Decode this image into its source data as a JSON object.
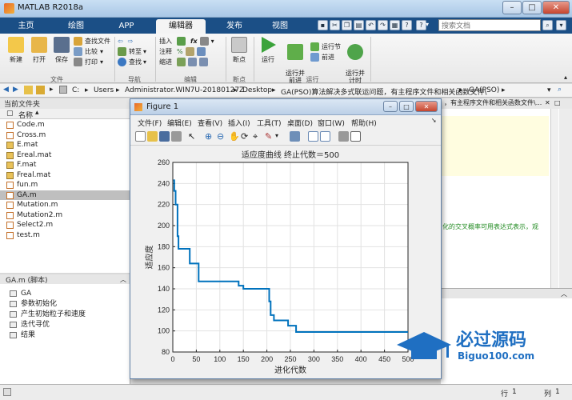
{
  "window": {
    "title": "MATLAB R2018a"
  },
  "tabs": [
    "主页",
    "绘图",
    "APP",
    "编辑器",
    "发布",
    "视图"
  ],
  "active_tab": "编辑器",
  "search": {
    "placeholder": "搜索文档"
  },
  "ribbon": {
    "file_group": {
      "label": "文件",
      "new": "新建",
      "open": "打开",
      "save": "保存",
      "find_files": "查找文件",
      "compare": "比较",
      "print": "打印"
    },
    "nav_group": {
      "label": "导航",
      "goto": "转至",
      "find": "查找"
    },
    "edit_group": {
      "label": "编辑",
      "insert": "插入",
      "comment": "注释",
      "indent": "缩进"
    },
    "breakpoint_group": {
      "label": "断点",
      "breakpoints": "断点"
    },
    "run_group": {
      "label": "运行",
      "run": "运行",
      "run_advance": "运行并\n前进",
      "run_section": "运行节",
      "advance": "前进",
      "run_time": "运行并\n计时"
    }
  },
  "address": {
    "path": [
      "C:",
      "Users",
      "Administrator.WIN7U-20180127Z",
      "Desktop",
      "GA(PSO)算法解决多式联运问题，有主程序文件和相关函数文件\\",
      "GA(PSO)"
    ]
  },
  "current_folder": {
    "title": "当前文件夹",
    "col_name": "名称",
    "files": [
      {
        "name": "Code.m",
        "type": "m"
      },
      {
        "name": "Cross.m",
        "type": "m"
      },
      {
        "name": "E.mat",
        "type": "mat"
      },
      {
        "name": "Ereal.mat",
        "type": "mat"
      },
      {
        "name": "F.mat",
        "type": "mat"
      },
      {
        "name": "Freal.mat",
        "type": "mat"
      },
      {
        "name": "fun.m",
        "type": "m"
      },
      {
        "name": "GA.m",
        "type": "m",
        "selected": true
      },
      {
        "name": "Mutation.m",
        "type": "m"
      },
      {
        "name": "Mutation2.m",
        "type": "m"
      },
      {
        "name": "Select2.m",
        "type": "m"
      },
      {
        "name": "test.m",
        "type": "m"
      }
    ]
  },
  "details": {
    "title": "GA.m  (脚本)",
    "outline": [
      "GA",
      "参数初始化",
      "产生初始粒子和速度",
      "迭代寻优",
      "结果"
    ]
  },
  "editor": {
    "tab_text": "，有主程序文件和相关函数文件\\...",
    "green_text": "化的交叉概率可用表达式表示，观"
  },
  "status": {
    "row_label": "行",
    "row_value": "1",
    "col_label": "列",
    "col_value": "1"
  },
  "figure": {
    "title": "Figure 1",
    "menu": [
      "文件(F)",
      "编辑(E)",
      "查看(V)",
      "插入(I)",
      "工具(T)",
      "桌面(D)",
      "窗口(W)",
      "帮助(H)"
    ]
  },
  "watermark": {
    "text": "必过源码",
    "sub": "Biguo100.com"
  },
  "chart_data": {
    "type": "line",
    "title": "适应度曲线  终止代数＝500",
    "xlabel": "进化代数",
    "ylabel": "适应度",
    "xlim": [
      0,
      500
    ],
    "ylim": [
      80,
      260
    ],
    "xticks": [
      0,
      50,
      100,
      150,
      200,
      250,
      300,
      350,
      400,
      450,
      500
    ],
    "yticks": [
      80,
      100,
      120,
      140,
      160,
      180,
      200,
      220,
      240,
      260
    ],
    "grid": true,
    "color": "#0072BD",
    "series": [
      {
        "x": [
          1,
          3,
          3,
          6,
          6,
          10,
          10,
          12,
          12,
          36,
          36,
          55,
          55,
          140,
          140,
          150,
          150,
          205,
          205,
          208,
          208,
          215,
          215,
          245,
          245,
          262,
          262,
          500
        ],
        "y": [
          243,
          243,
          233,
          233,
          220,
          220,
          190,
          190,
          178,
          178,
          164,
          164,
          147,
          147,
          143,
          143,
          140,
          140,
          128,
          128,
          115,
          115,
          110,
          110,
          105,
          105,
          99,
          99
        ]
      }
    ]
  }
}
